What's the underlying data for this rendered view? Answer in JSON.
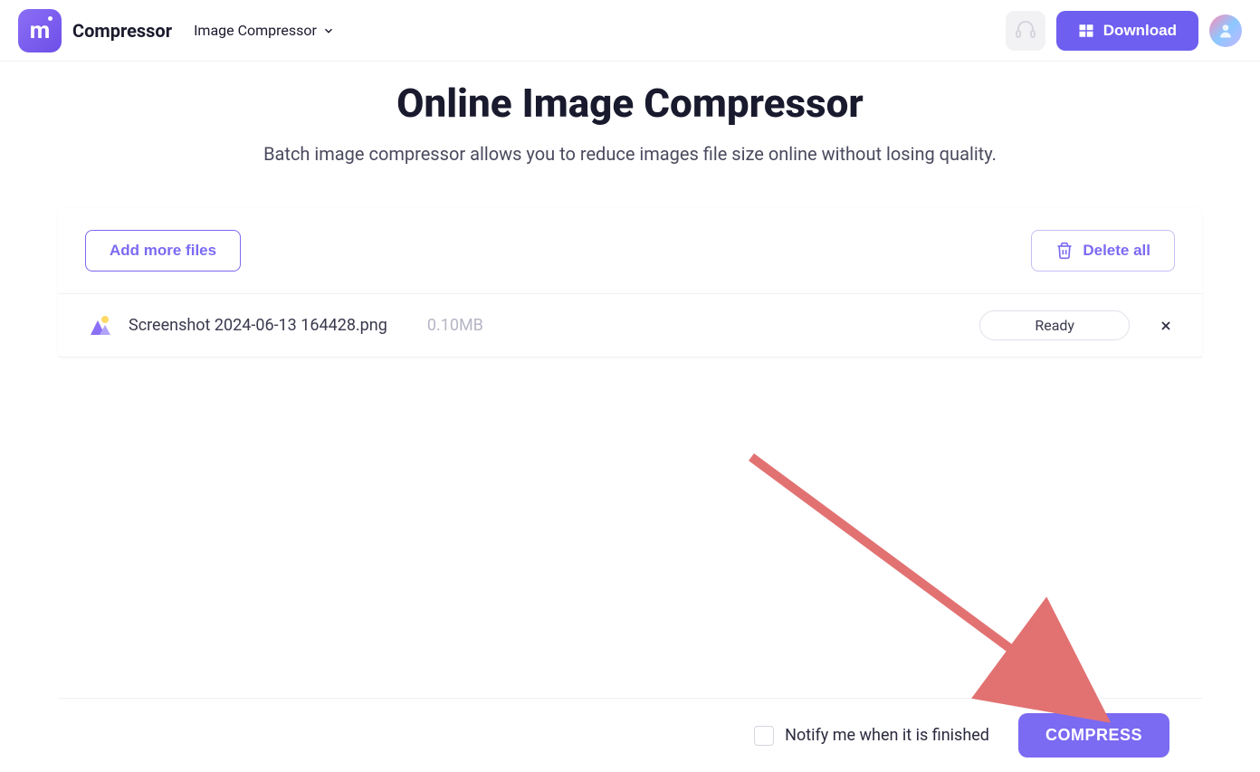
{
  "header": {
    "brand_name": "Compressor",
    "nav_dropdown_label": "Image Compressor",
    "download_label": "Download"
  },
  "page": {
    "title": "Online Image Compressor",
    "subtitle": "Batch image compressor allows you to reduce images file size online without losing quality."
  },
  "toolbar": {
    "add_files_label": "Add more files",
    "delete_all_label": "Delete all"
  },
  "files": [
    {
      "name": "Screenshot 2024-06-13 164428.png",
      "size": "0.10MB",
      "status": "Ready"
    }
  ],
  "footer": {
    "notify_label": "Notify me when it is finished",
    "compress_label": "COMPRESS"
  }
}
